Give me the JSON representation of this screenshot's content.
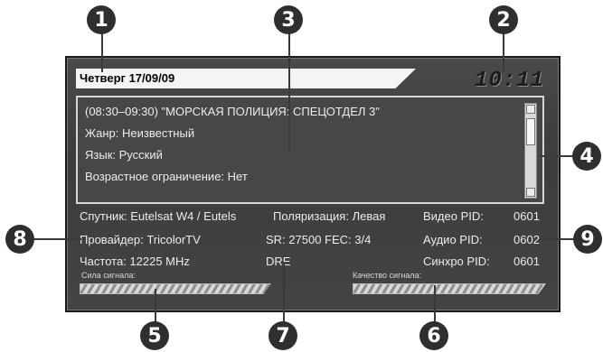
{
  "markers": [
    "1",
    "2",
    "3",
    "4",
    "5",
    "6",
    "7",
    "8",
    "9"
  ],
  "header": {
    "date": "Четверг 17/09/09",
    "time": "10:11"
  },
  "event": {
    "title": "(08:30–09:30) \"МОРСКАЯ ПОЛИЦИЯ: СПЕЦОТДЕЛ 3\"",
    "genre": "Жанр: Неизвестный",
    "language": "Язык: Русский",
    "age_rating": "Возрастное ограничение: Нет"
  },
  "channel": {
    "satellite": "Спутник: Eutelsat W4 / Eutels",
    "polarization": "Поляризация: Левая",
    "provider": "Провайдер: TricolorTV",
    "sr_fec": "SR: 27500  FEC: 3/4",
    "frequency": "Частота: 12225 MHz",
    "encryption": "DRE",
    "video_pid_label": "Видео PID:",
    "video_pid": "0601",
    "audio_pid_label": "Аудио PID:",
    "audio_pid": "0602",
    "sync_pid_label": "Синхро PID:",
    "sync_pid": "0601"
  },
  "signal": {
    "strength_label": "Сила сигнала:",
    "quality_label": "Качество сигнала:"
  },
  "colors": {
    "panel": "#444444",
    "marker": "#2f2f2f",
    "text": "#ececec"
  }
}
